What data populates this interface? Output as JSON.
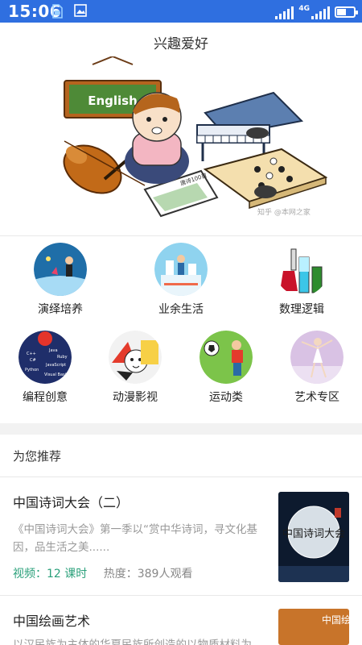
{
  "status_bar": {
    "time": "15:06",
    "network": "4G",
    "icons": [
      "sim-icon",
      "gallery-icon",
      "signal-icon",
      "signal-4g-icon",
      "battery-icon"
    ],
    "battery_level": 0.5,
    "color": "#2f6fe0"
  },
  "header": {
    "title": "兴趣爱好"
  },
  "banner": {
    "banner_text": "English",
    "book_text": "唐诗100首",
    "watermark": "知乎 @本网之家"
  },
  "categories": [
    {
      "label": "演绎培养",
      "icon": "performance-icon"
    },
    {
      "label": "业余生活",
      "icon": "leisure-icon"
    },
    {
      "label": "数理逻辑",
      "icon": "science-icon"
    },
    {
      "label": "编程创意",
      "icon": "programming-icon"
    },
    {
      "label": "动漫影视",
      "icon": "anime-icon"
    },
    {
      "label": "运动类",
      "icon": "sports-icon"
    },
    {
      "label": "艺术专区",
      "icon": "art-icon"
    }
  ],
  "programming_icon_text": [
    "C++",
    "Java",
    "C#",
    "Ruby",
    "JavaScript",
    "Python",
    "Visual Basic"
  ],
  "recommend": {
    "section_title": "为您推荐",
    "items": [
      {
        "title": "中国诗词大会（二）",
        "desc": "《中国诗词大会》第一季以“赏中华诗词，寻文化基因，品生活之美......",
        "video": "视频：12 课时",
        "hot": "热度：389人观看",
        "thumb_text": "中国诗词大会"
      },
      {
        "title": "中国绘画艺术",
        "desc": "以汉民族为主体的华夏民族所创造的以物质材料为",
        "thumb_text": "中国绘"
      }
    ]
  }
}
